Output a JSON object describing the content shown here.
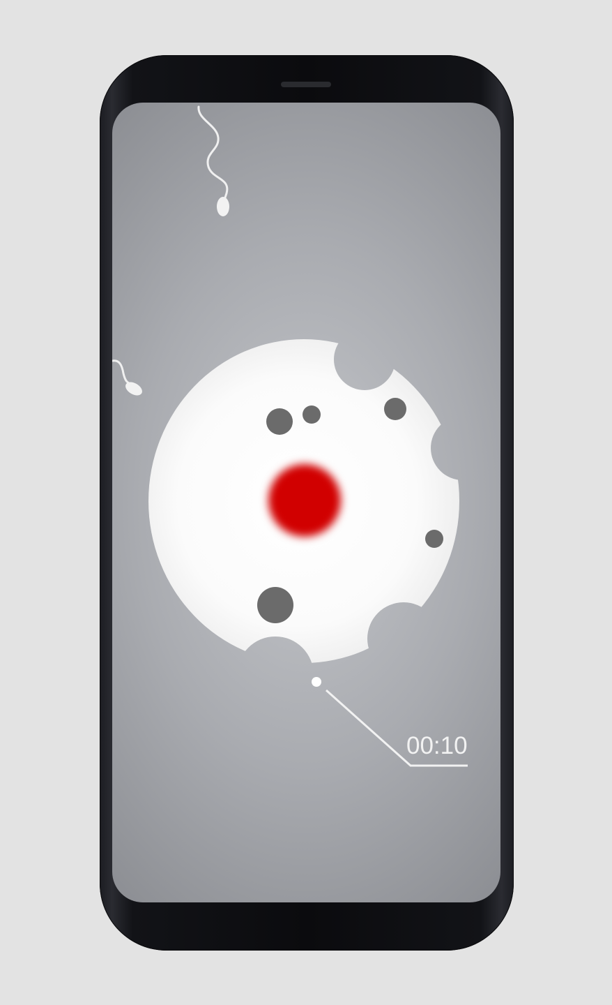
{
  "game": {
    "timer_text": "00:10",
    "colors": {
      "background": "#e3e3e3",
      "screen": "#a9abb0",
      "cell": "#ffffff",
      "nucleus": "#d10000",
      "spots": "#6b6b6b",
      "sperm": "#f2f2f2"
    },
    "sprites": [
      "sperm-icon",
      "sperm-icon",
      "egg-cell",
      "nucleus",
      "launcher-dot"
    ]
  }
}
